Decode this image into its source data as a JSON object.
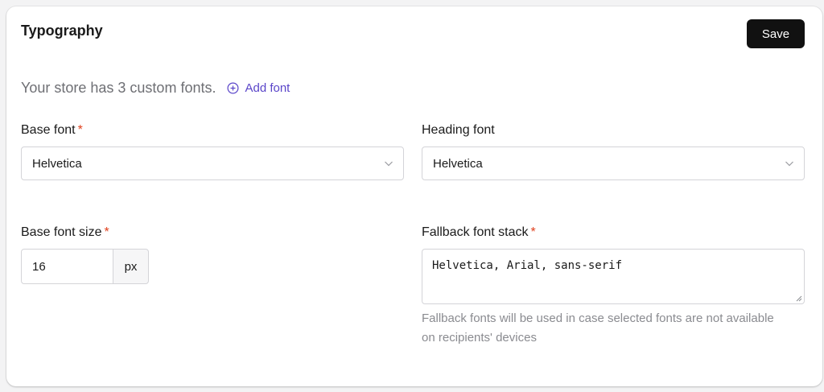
{
  "header": {
    "title": "Typography",
    "save_label": "Save"
  },
  "summary": {
    "text": "Your store has 3 custom fonts.",
    "add_font_label": "Add font"
  },
  "fields": {
    "base_font": {
      "label": "Base font",
      "required_mark": "*",
      "value": "Helvetica"
    },
    "heading_font": {
      "label": "Heading font",
      "value": "Helvetica"
    },
    "base_font_size": {
      "label": "Base font size",
      "required_mark": "*",
      "value": "16",
      "unit": "px"
    },
    "fallback_stack": {
      "label": "Fallback font stack",
      "required_mark": "*",
      "value": "Helvetica, Arial, sans-serif",
      "helper": "Fallback fonts will be used in case selected fonts are not available on recipients' devices"
    }
  },
  "icons": {
    "add": "plus-circle-icon",
    "dropdown": "chevron-down-icon",
    "resize": "resize-handle-icon"
  },
  "colors": {
    "accent": "#5a45c9",
    "required": "#e0401d",
    "button_bg": "#111111"
  }
}
